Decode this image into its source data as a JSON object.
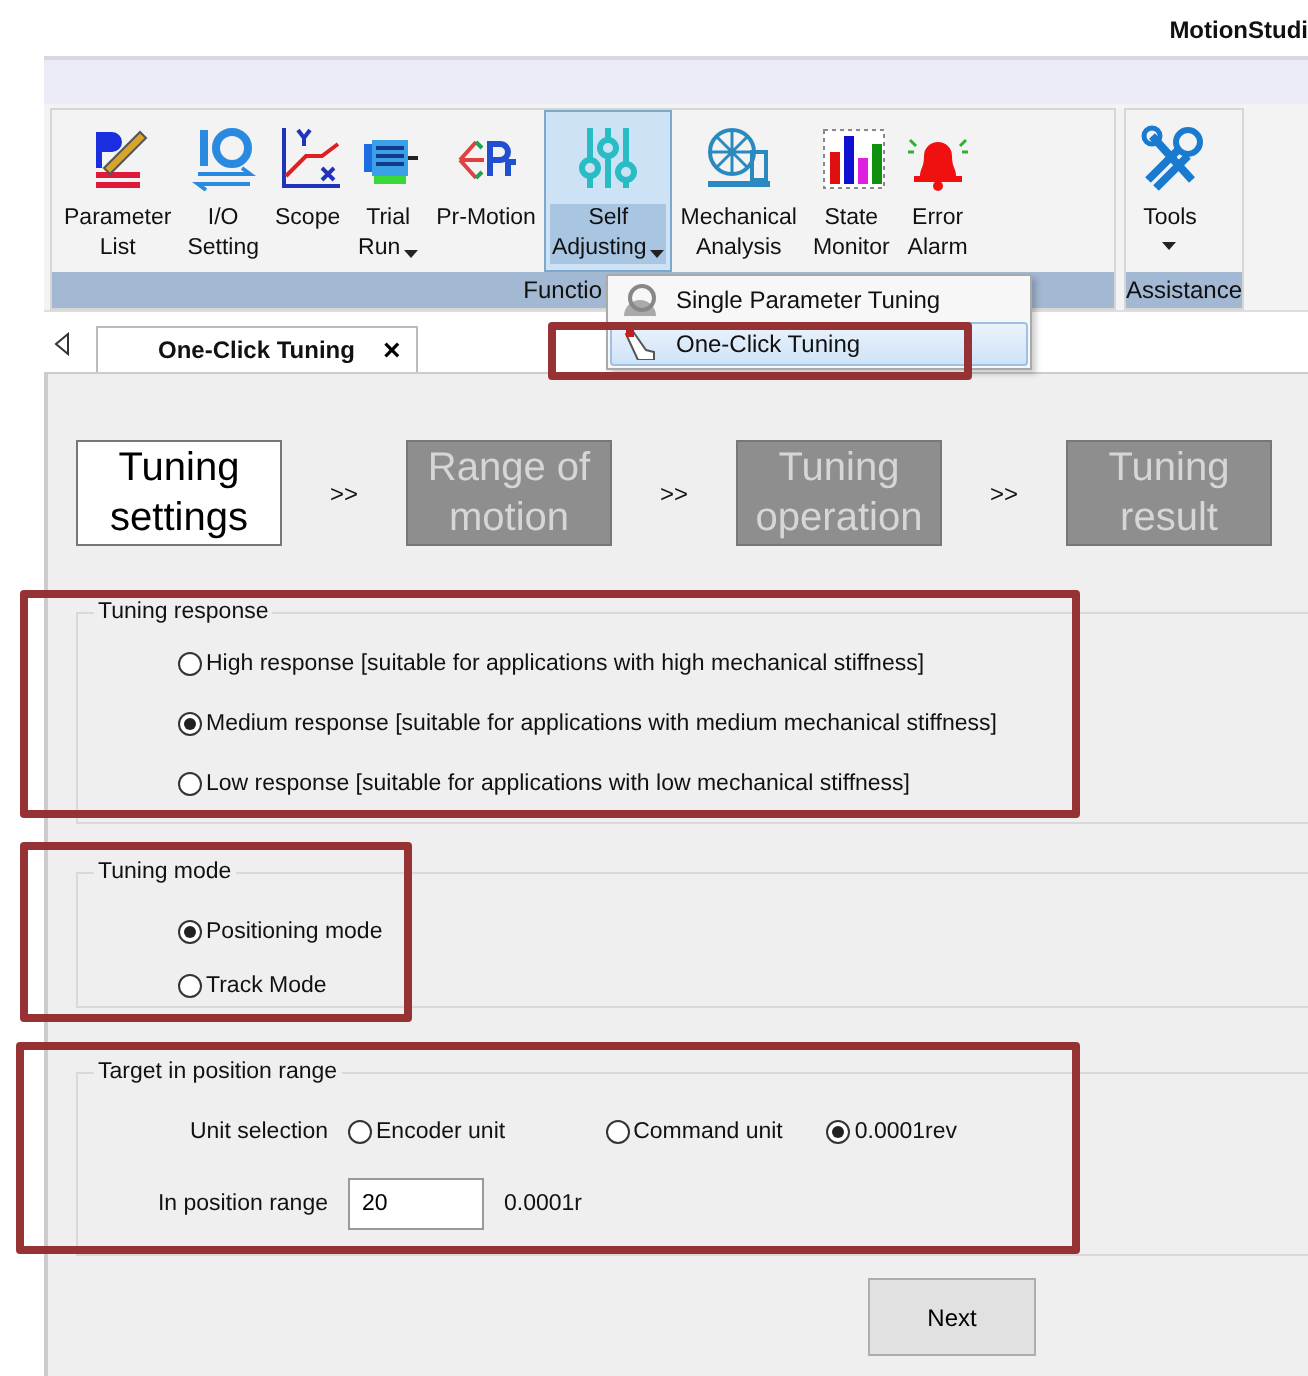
{
  "app_title": "MotionStudi",
  "ribbon": {
    "groups": [
      {
        "label": "Functio",
        "buttons": [
          {
            "lines": [
              "Parameter",
              "List"
            ],
            "has_menu": false,
            "selected": false
          },
          {
            "lines": [
              "I/O",
              "Setting"
            ],
            "has_menu": false,
            "selected": false
          },
          {
            "lines": [
              "Scope"
            ],
            "has_menu": false,
            "selected": false
          },
          {
            "lines": [
              "Trial",
              "Run"
            ],
            "has_menu": true,
            "selected": false
          },
          {
            "lines": [
              "Pr-Motion"
            ],
            "has_menu": false,
            "selected": false
          },
          {
            "lines": [
              "Self",
              "Adjusting"
            ],
            "has_menu": true,
            "selected": true
          },
          {
            "lines": [
              "Mechanical",
              "Analysis"
            ],
            "has_menu": false,
            "selected": false
          },
          {
            "lines": [
              "State",
              "Monitor"
            ],
            "has_menu": false,
            "selected": false
          },
          {
            "lines": [
              "Error",
              "Alarm"
            ],
            "has_menu": false,
            "selected": false
          }
        ]
      },
      {
        "label": "Assistance",
        "buttons": [
          {
            "lines": [
              "Tools"
            ],
            "has_menu": true,
            "selected": false
          }
        ]
      }
    ]
  },
  "dropdown_menu": [
    {
      "label": "Single Parameter Tuning",
      "selected": false
    },
    {
      "label": "One-Click Tuning",
      "selected": true
    }
  ],
  "tabs": [
    {
      "label": "One-Click Tuning",
      "selected": true,
      "close": "×"
    }
  ],
  "steps": [
    {
      "label": "Tuning settings",
      "selected": true
    },
    {
      "label": "Range of motion",
      "selected": false,
      "prefix": ">>"
    },
    {
      "label": "Tuning operation",
      "selected": false,
      "prefix": ">>"
    },
    {
      "label": "Tuning result",
      "selected": false,
      "prefix": ">>"
    }
  ],
  "tuning_response": {
    "title": "Tuning response",
    "options": [
      {
        "label": "High response [suitable for applications with high mechanical stiffness]",
        "selected": false
      },
      {
        "label": "Medium response [suitable for applications with medium mechanical stiffness]",
        "selected": true
      },
      {
        "label": "Low response [suitable for applications with low mechanical stiffness]",
        "selected": false
      }
    ]
  },
  "tuning_mode": {
    "title": "Tuning mode",
    "options": [
      {
        "label": "Positioning mode",
        "selected": true
      },
      {
        "label": "Track Mode",
        "selected": false
      }
    ]
  },
  "target": {
    "title": "Target in position range",
    "unit_label": "Unit selection",
    "units": [
      {
        "label": "Encoder unit",
        "selected": false
      },
      {
        "label": "Command unit",
        "selected": false
      },
      {
        "label": "0.0001rev",
        "selected": true
      }
    ],
    "range_label": "In position range",
    "range_value": "20",
    "range_unit": "0.0001r"
  },
  "next_button": "Next"
}
